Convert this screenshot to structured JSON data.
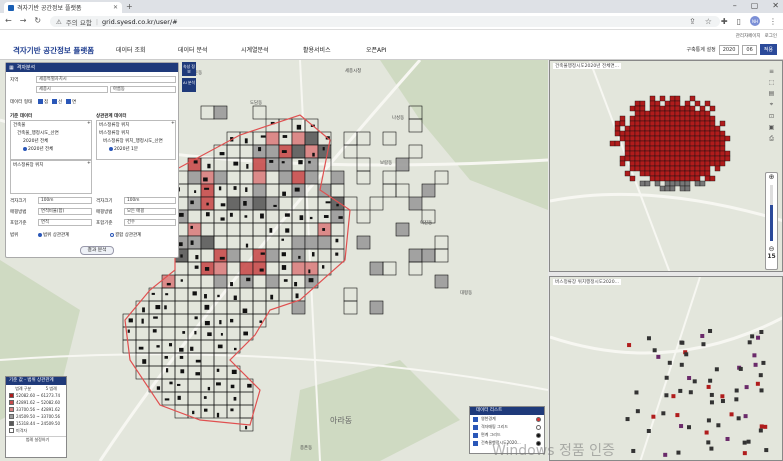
{
  "browser": {
    "tab_title": "격자기반 공간정보 플랫폼",
    "security_warning": "주의 요함",
    "url": "grid.syesd.co.kr/user/#",
    "profile_initials": "NH"
  },
  "header": {
    "logo": "격자기반 공간정보 플랫폼",
    "nav": [
      "데이터 조회",
      "데이터 분석",
      "시계열분석",
      "활용서비스",
      "오픈API"
    ],
    "util_links": [
      "관리자페이지",
      "로그인"
    ],
    "time_label": "구축통계 설정",
    "year": "2020",
    "month": "06",
    "apply_btn": "적용"
  },
  "panel": {
    "title": "격자분석",
    "region_label": "지역",
    "region_value": "세종특별자치시",
    "sub_region_value": "세종시",
    "sub_region2_value": "아름동",
    "data_type_label": "데이터 형태",
    "data_types": [
      "점",
      "선",
      "면"
    ],
    "base_data_label": "기준 데이터",
    "comp_data_label": "상관관계 데이터",
    "base_section": "건축물",
    "base_item": "건축물_행정시도_산면",
    "base_year_a": "2020년 전체",
    "base_year_b": "2020년 전체",
    "comp_section": "버스정류장 위치",
    "comp_item": "버스정류장 위치_행정시도_산면",
    "comp_year": "2020년 1분",
    "bus_label": "버스정류장 위치",
    "grid_size_label": "격자크기",
    "grid_size_a": "100m",
    "grid_size_b": "100m",
    "method_label": "매핑방법",
    "method_a": "면적비율(합)",
    "method_b": "모든 매핑",
    "representative_label": "포함기준",
    "representative_a": "면적",
    "representative_b": "건수",
    "range_label": "범위",
    "range_opt_a": "범위 상관관계",
    "range_opt_b": "결합 상관관계",
    "run_btn": "결과 분석"
  },
  "map_buttons": {
    "top": "속성 정보",
    "bottom": "AI 분석"
  },
  "legend": {
    "title": "기준 값 - 범위 상관관계",
    "col_a": "범례 구분",
    "col_b": "5 범례",
    "items": [
      {
        "label": "52082.60 ~ 61273.74",
        "color": "#b01c1c"
      },
      {
        "label": "42891.62 ~ 52082.60",
        "color": "#c84c4c"
      },
      {
        "label": "33700.56 ~ 42891.62",
        "color": "#d98080"
      },
      {
        "label": "24509.50 ~ 33700.56",
        "color": "#9a9a9a"
      },
      {
        "label": "15318.44 ~ 24509.50",
        "color": "#5a5a5a"
      },
      {
        "label": "미격자",
        "color": "#ffffff"
      }
    ],
    "footer": "범례 설정하기"
  },
  "data_list": {
    "title": "데이터 리스트",
    "items": [
      {
        "label": "영천경계",
        "color": "#d33"
      },
      {
        "label": "격자매핑 그리드",
        "color": "#fff"
      },
      {
        "label": "면계 그리드",
        "color": "#111"
      },
      {
        "label": "건축물행정시도2020...",
        "color": "#111"
      }
    ]
  },
  "mini_maps": {
    "top_title": "건축물행정시도2020년 전체면...",
    "bottom_title": "버스정류장 위치행정시도2020..."
  },
  "zoom_level": "15",
  "place_labels": [
    "아라동",
    "세종시청",
    "나성동",
    "어진동",
    "도담동",
    "보람동",
    "대평동",
    "종촌동",
    "고운동",
    "아름동",
    "새롬동",
    "다정동",
    "한솔동",
    "가람동"
  ],
  "watermark": "Windows 정품 인증"
}
